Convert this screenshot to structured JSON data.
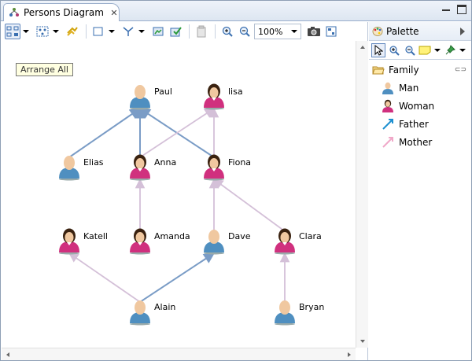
{
  "editor": {
    "tab_title": "Persons Diagram",
    "zoom_level": "100%",
    "tooltip": "Arrange All"
  },
  "palette": {
    "title": "Palette",
    "group_label": "Family",
    "items": [
      {
        "label": "Man",
        "icon": "man-icon"
      },
      {
        "label": "Woman",
        "icon": "woman-icon"
      },
      {
        "label": "Father",
        "icon": "father-link-icon"
      },
      {
        "label": "Mother",
        "icon": "mother-link-icon"
      }
    ]
  },
  "colors": {
    "father_link": "#7a9cc6",
    "mother_link": "#d4c0d8",
    "man_body": "#4f8fc0",
    "woman_body": "#d0307e",
    "skin": "#f0c8a0"
  },
  "diagram": {
    "persons": [
      {
        "id": "paul",
        "name": "Paul",
        "gender": "man"
      },
      {
        "id": "lisa",
        "name": "lisa",
        "gender": "woman"
      },
      {
        "id": "elias",
        "name": "Elias",
        "gender": "man"
      },
      {
        "id": "anna",
        "name": "Anna",
        "gender": "woman"
      },
      {
        "id": "fiona",
        "name": "Fiona",
        "gender": "woman"
      },
      {
        "id": "katell",
        "name": "Katell",
        "gender": "woman"
      },
      {
        "id": "amanda",
        "name": "Amanda",
        "gender": "woman"
      },
      {
        "id": "dave",
        "name": "Dave",
        "gender": "man"
      },
      {
        "id": "clara",
        "name": "Clara",
        "gender": "woman"
      },
      {
        "id": "alain",
        "name": "Alain",
        "gender": "man"
      },
      {
        "id": "bryan",
        "name": "Bryan",
        "gender": "man"
      }
    ],
    "links": [
      {
        "from": "elias",
        "to": "paul",
        "type": "father"
      },
      {
        "from": "anna",
        "to": "paul",
        "type": "father"
      },
      {
        "from": "fiona",
        "to": "paul",
        "type": "father"
      },
      {
        "from": "anna",
        "to": "lisa",
        "type": "mother"
      },
      {
        "from": "fiona",
        "to": "lisa",
        "type": "mother"
      },
      {
        "from": "amanda",
        "to": "anna",
        "type": "mother"
      },
      {
        "from": "dave",
        "to": "fiona",
        "type": "mother"
      },
      {
        "from": "clara",
        "to": "fiona",
        "type": "mother"
      },
      {
        "from": "alain",
        "to": "katell",
        "type": "mother"
      },
      {
        "from": "alain",
        "to": "dave",
        "type": "father"
      },
      {
        "from": "bryan",
        "to": "clara",
        "type": "mother"
      }
    ]
  }
}
